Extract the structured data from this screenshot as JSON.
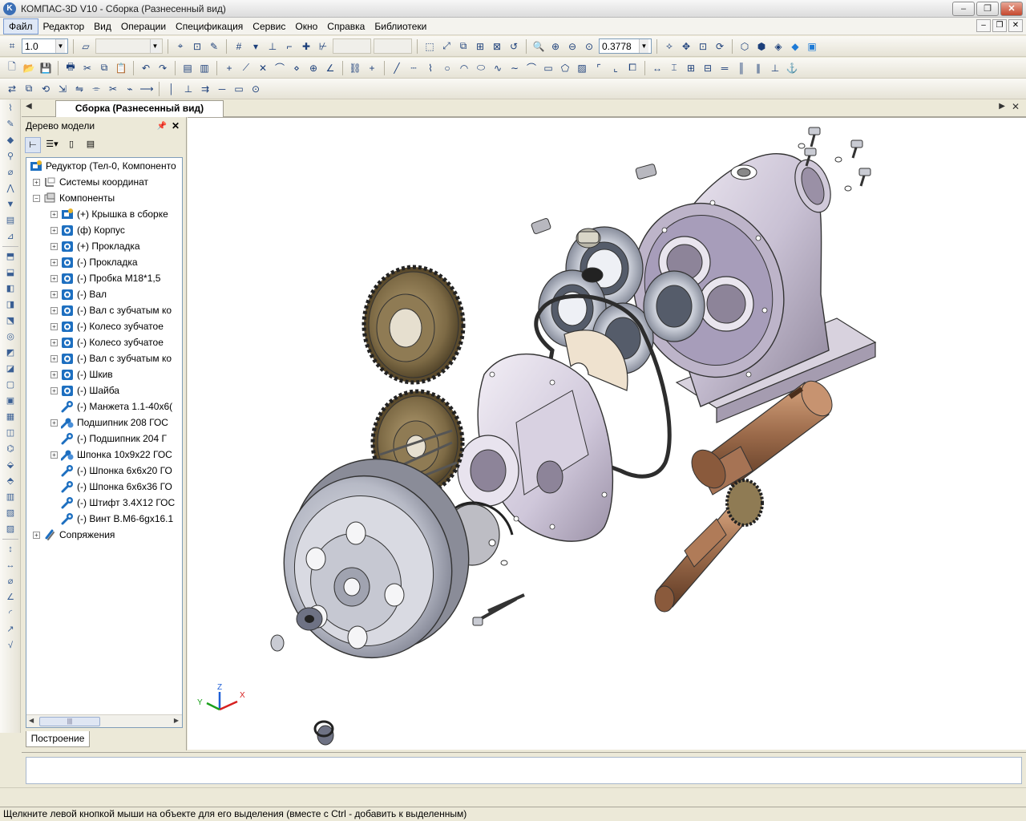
{
  "window": {
    "title": "КОМПАС-3D V10 - Сборка (Разнесенный вид)",
    "icon": "kompas-icon",
    "buttons": [
      "minimize",
      "maximize",
      "close"
    ]
  },
  "menu": [
    "Файл",
    "Редактор",
    "Вид",
    "Операции",
    "Спецификация",
    "Сервис",
    "Окно",
    "Справка",
    "Библиотеки"
  ],
  "toolbar": {
    "step_value": "1.0",
    "zoom_value": "0.3778"
  },
  "document_tab": "Сборка (Разнесенный вид)",
  "tree": {
    "title": "Дерево модели",
    "root": "Редуктор (Тел-0, Компоненто",
    "coordinate_systems": "Системы координат",
    "components_group": "Компоненты",
    "components": [
      {
        "label": "(+) Крышка в сборке",
        "icon": "subassembly-icon"
      },
      {
        "label": "(ф) Корпус",
        "icon": "part-icon"
      },
      {
        "label": "(+) Прокладка",
        "icon": "part-icon"
      },
      {
        "label": "(-) Прокладка",
        "icon": "part-icon"
      },
      {
        "label": "(-) Пробка М18*1,5",
        "icon": "part-icon"
      },
      {
        "label": "(-) Вал",
        "icon": "part-icon"
      },
      {
        "label": "(-) Вал с зубчатым ко",
        "icon": "part-icon"
      },
      {
        "label": "(-) Колесо зубчатое",
        "icon": "part-icon"
      },
      {
        "label": "(-) Колесо зубчатое",
        "icon": "part-icon"
      },
      {
        "label": "(-) Вал с зубчатым ко",
        "icon": "part-icon"
      },
      {
        "label": "(-) Шкив",
        "icon": "part-icon"
      },
      {
        "label": "(-) Шайба",
        "icon": "part-icon"
      },
      {
        "label": "(-) Манжета 1.1-40х6(",
        "icon": "standard-part-icon"
      },
      {
        "label": "Подшипник 208 ГОС",
        "icon": "standard-array-icon"
      },
      {
        "label": "(-) Подшипник 204 Г",
        "icon": "standard-part-icon"
      },
      {
        "label": "Шпонка 10х9х22 ГОС",
        "icon": "standard-array-icon"
      },
      {
        "label": "(-) Шпонка 6х6х20 ГО",
        "icon": "standard-part-icon"
      },
      {
        "label": "(-) Шпонка 6х6х36 ГО",
        "icon": "standard-part-icon"
      },
      {
        "label": "(-) Штифт 3.4Х12 ГОС",
        "icon": "standard-part-icon"
      },
      {
        "label": "(-) Винт В.М6-6gx16.1",
        "icon": "standard-part-icon"
      }
    ],
    "mates": "Сопряжения",
    "bottom_tab": "Построение"
  },
  "axes": {
    "x": "X",
    "y": "Y",
    "z": "Z"
  },
  "status": "Щелкните левой кнопкой мыши на объекте для его выделения (вместе с Ctrl - добавить к выделенным)",
  "colors": {
    "housing": "#c9c1d4",
    "gear": "#7d6a45",
    "shaft": "#9b6a4a",
    "pulley": "#b7bac6",
    "gasket": "#2d2d2d",
    "tree_icon": "#1d6fc0"
  }
}
